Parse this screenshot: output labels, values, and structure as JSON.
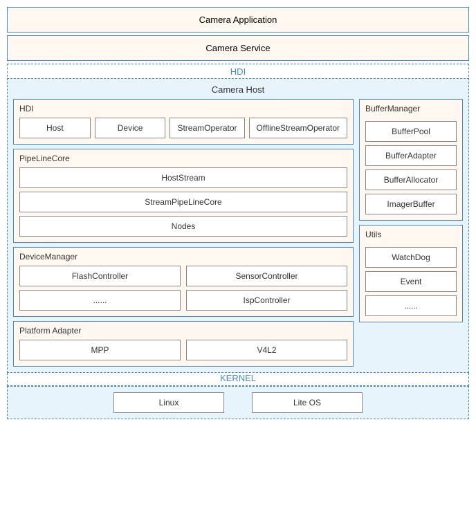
{
  "camera_application": "Camera Application",
  "camera_service": "Camera Service",
  "hdi_label": "HDI",
  "kernel_label": "KERNEL",
  "camera_host": {
    "title": "Camera Host",
    "left": {
      "hdi": {
        "title": "HDI",
        "components": [
          "Host",
          "Device",
          "StreamOperator",
          "OfflineStreamOperator"
        ]
      },
      "pipeline": {
        "title": "PipeLineCore",
        "components": [
          "HostStream",
          "StreamPipeLineCore",
          "Nodes"
        ]
      },
      "device": {
        "title": "DeviceManager",
        "col1": [
          "FlashController",
          "......"
        ],
        "col2": [
          "SensorController",
          "IspController"
        ]
      },
      "platform": {
        "title": "Platform Adapter",
        "components": [
          "MPP",
          "V4L2"
        ]
      }
    },
    "right": {
      "buffer": {
        "title": "BufferManager",
        "components": [
          "BufferPool",
          "BufferAdapter",
          "BufferAllocator",
          "ImagerBuffer"
        ]
      },
      "utils": {
        "title": "Utils",
        "components": [
          "WatchDog",
          "Event",
          "......"
        ]
      }
    }
  },
  "kernel": {
    "components": [
      "Linux",
      "Lite OS"
    ]
  }
}
